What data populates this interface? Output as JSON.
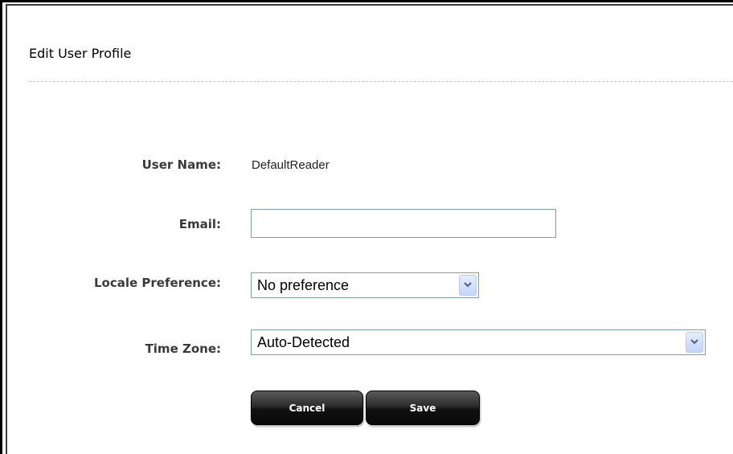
{
  "form": {
    "title": "Edit User Profile",
    "fields": {
      "username": {
        "label": "User Name:",
        "value": "DefaultReader"
      },
      "email": {
        "label": "Email:",
        "value": "",
        "placeholder": ""
      },
      "locale": {
        "label": "Locale Preference:",
        "selected": "No preference"
      },
      "timezone": {
        "label": "Time Zone:",
        "selected": "Auto-Detected"
      }
    },
    "buttons": {
      "cancel": "Cancel",
      "save": "Save"
    }
  },
  "icons": {
    "dropdown": "chevron-down-icon"
  },
  "colors": {
    "input_border": "#7f9db9",
    "button_bg": "#1a1a1a",
    "label_text": "#3a3a3a"
  }
}
